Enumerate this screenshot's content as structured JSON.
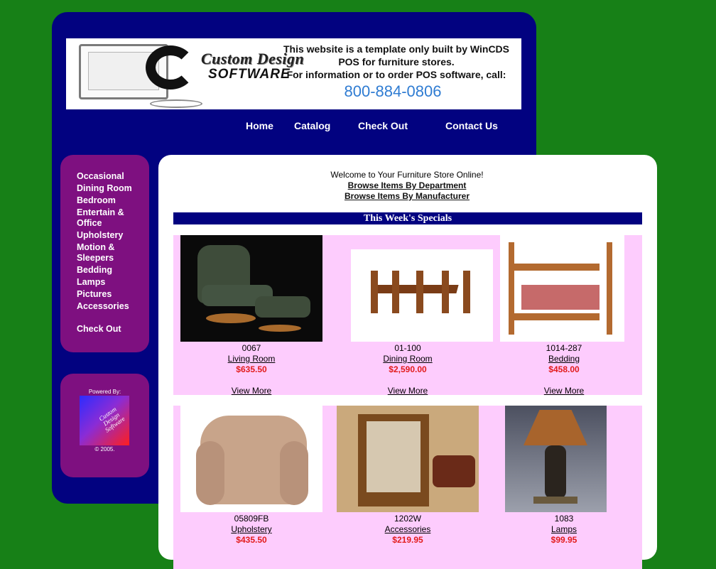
{
  "banner": {
    "logo_line1": "Custom Design",
    "logo_line2": "SOFTWARE",
    "info_line1": "This website is a template only built by WinCDS",
    "info_line2": "POS for furniture stores.",
    "info_line3": "For information or to order POS software, call:",
    "phone": "800-884-0806"
  },
  "nav": {
    "home": "Home",
    "catalog": "Catalog",
    "checkout": "Check Out",
    "contact": "Contact Us"
  },
  "sidebar": {
    "items": [
      {
        "label": "Occasional"
      },
      {
        "label": "Dining Room"
      },
      {
        "label": "Bedroom"
      },
      {
        "label": "Entertain & Office"
      },
      {
        "label": "Upholstery"
      },
      {
        "label": "Motion & Sleepers"
      },
      {
        "label": "Bedding"
      },
      {
        "label": "Lamps"
      },
      {
        "label": "Pictures"
      },
      {
        "label": "Accessories"
      }
    ],
    "checkout": "Check Out",
    "powered_by": "Powered By:",
    "badge_text": "Custom Design Software",
    "copyright": "© 2005."
  },
  "content": {
    "welcome": "Welcome to Your Furniture Store Online!",
    "browse_department": "Browse Items By Department",
    "browse_manufacturer": "Browse Items By Manufacturer",
    "specials_title": "This Week's Specials",
    "view_more": "View More",
    "products": [
      {
        "code": "0067",
        "category": "Living Room",
        "price": "$635.50"
      },
      {
        "code": "01-100",
        "category": "Dining Room",
        "price": "$2,590.00"
      },
      {
        "code": "1014-287",
        "category": "Bedding",
        "price": "$458.00"
      },
      {
        "code": "05809FB",
        "category": "Upholstery",
        "price": "$435.50"
      },
      {
        "code": "1202W",
        "category": "Accessories",
        "price": "$219.95"
      },
      {
        "code": "1083",
        "category": "Lamps",
        "price": "$99.95"
      }
    ]
  }
}
